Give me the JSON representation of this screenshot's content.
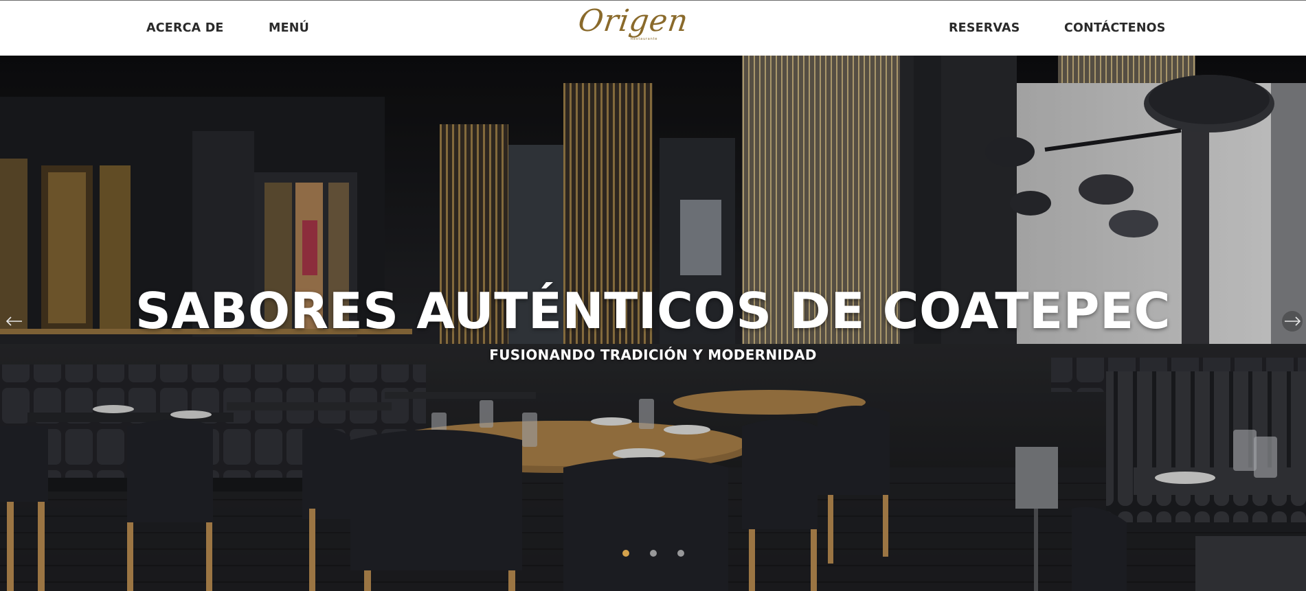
{
  "nav": {
    "left": [
      {
        "label": "ACERCA DE"
      },
      {
        "label": "MENÚ"
      }
    ],
    "right": [
      {
        "label": "RESERVAS"
      },
      {
        "label": "CONTÁCTENOS"
      }
    ]
  },
  "logo": {
    "wordmark": "Origen",
    "sub": "Restaurante"
  },
  "hero": {
    "title": "SABORES AUTÉNTICOS DE COATEPEC",
    "subtitle": "FUSIONANDO TRADICIÓN Y MODERNIDAD",
    "slides": 3,
    "active_slide": 1
  },
  "colors": {
    "brand_gold": "#8a6a2b",
    "nav_text": "#2a2a2a",
    "active_dot": "#d4a24c"
  },
  "icons": {
    "prev": "arrow-left-icon",
    "next": "arrow-right-icon"
  }
}
